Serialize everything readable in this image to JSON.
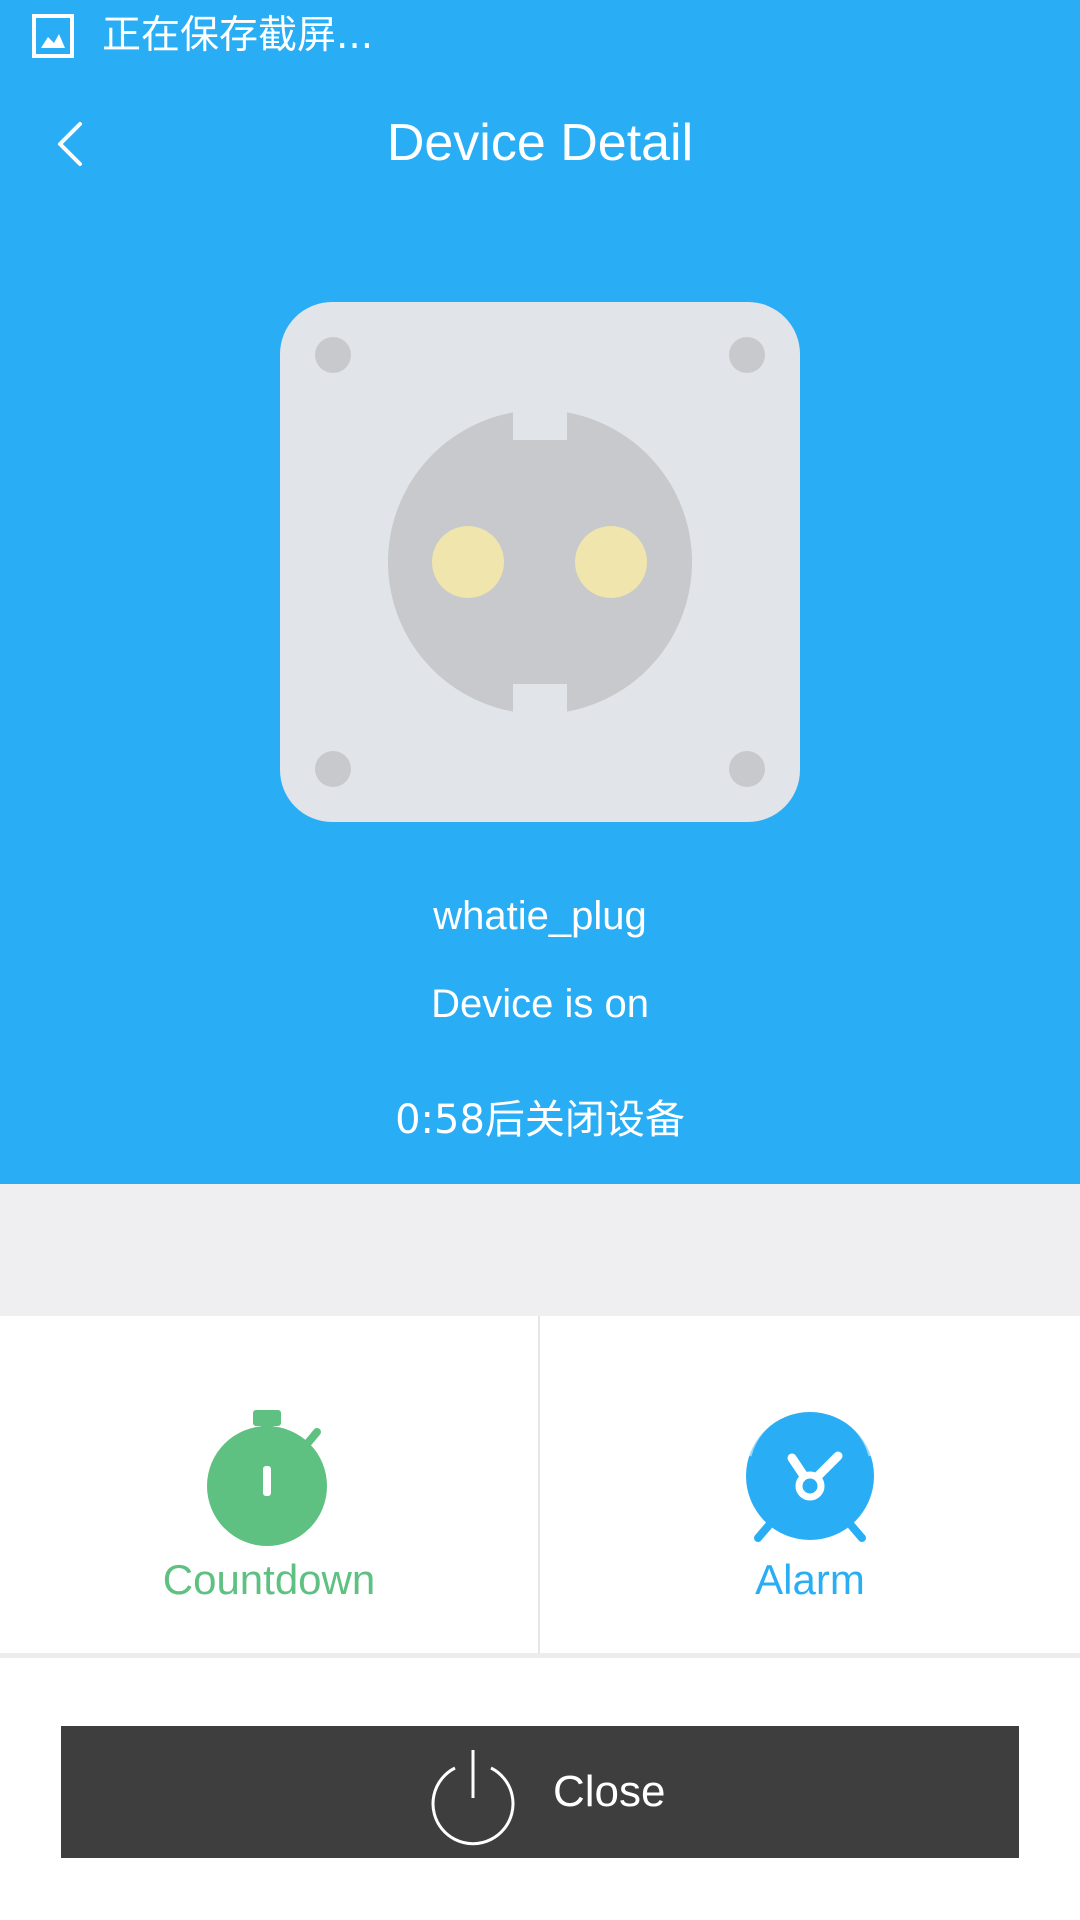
{
  "status_bar": {
    "notification_text": "正在保存截屏...",
    "icon": "screenshot-icon"
  },
  "header": {
    "title": "Device Detail",
    "back_icon": "chevron-left-icon",
    "background_color": "#29aef6"
  },
  "device": {
    "image": "power-socket-icon",
    "name": "whatie_plug",
    "state": "Device is on",
    "timer_info": "0:58后关闭设备"
  },
  "actions": [
    {
      "label": "Countdown",
      "icon": "stopwatch-icon",
      "color": "#5ec182"
    },
    {
      "label": "Alarm",
      "icon": "alarm-clock-icon",
      "color": "#29aef6"
    }
  ],
  "close_button": {
    "label": "Close",
    "icon": "power-icon",
    "background_color": "#3e3e3e"
  }
}
